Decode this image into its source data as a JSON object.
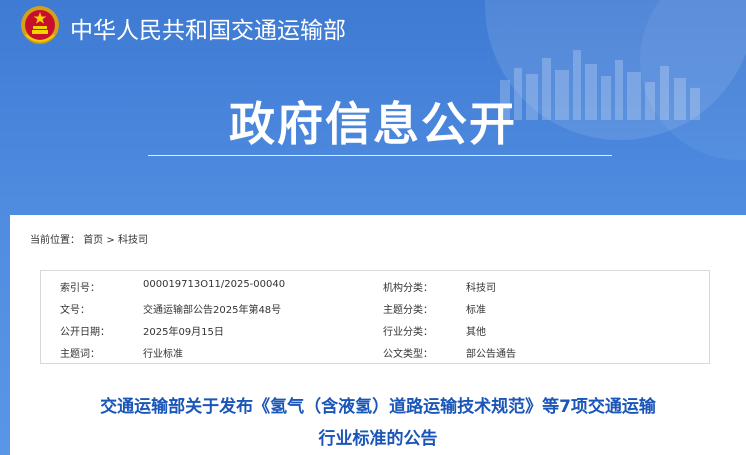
{
  "header": {
    "ministry_name": "中华人民共和国交通运输部",
    "banner_title": "政府信息公开"
  },
  "breadcrumb": {
    "label": "当前位置：",
    "items": [
      "首页",
      "科技司"
    ],
    "separator": ">"
  },
  "meta": {
    "rows": [
      {
        "l1": "索引号：",
        "v1": "000019713O11/2025-00040",
        "l2": "机构分类：",
        "v2": "科技司"
      },
      {
        "l1": "文号：",
        "v1": "交通运输部公告2025年第48号",
        "l2": "主题分类：",
        "v2": "标准"
      },
      {
        "l1": "公开日期：",
        "v1": "2025年09月15日",
        "l2": "行业分类：",
        "v2": "其他"
      },
      {
        "l1": "主题词：",
        "v1": "行业标准",
        "l2": "公文类型：",
        "v2": "部公告通告"
      }
    ]
  },
  "document": {
    "title_line1": "交通运输部关于发布《氢气（含液氢）道路运输技术规范》等7项交通运输",
    "title_line2": "行业标准的公告"
  },
  "colors": {
    "banner": "#4a84d8",
    "title_blue": "#1a56b8"
  }
}
